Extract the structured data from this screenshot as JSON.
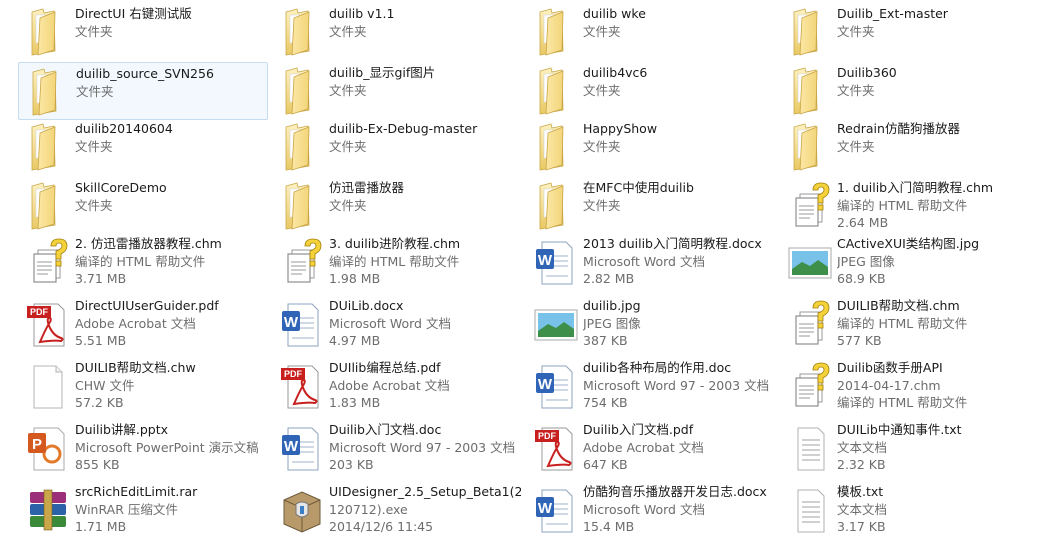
{
  "items": [
    {
      "name": "DirectUI 右键测试版",
      "lines": [
        "文件夹"
      ],
      "icon": "folder-icon"
    },
    {
      "name": "duilib v1.1",
      "lines": [
        "文件夹"
      ],
      "icon": "folder-icon"
    },
    {
      "name": "duilib wke",
      "lines": [
        "文件夹"
      ],
      "icon": "folder-icon"
    },
    {
      "name": "Duilib_Ext-master",
      "lines": [
        "文件夹"
      ],
      "icon": "folder-icon"
    },
    {
      "name": "duilib_source_SVN256",
      "lines": [
        "文件夹"
      ],
      "icon": "folder-icon",
      "selected": true
    },
    {
      "name": "duilib_显示gif图片",
      "lines": [
        "文件夹"
      ],
      "icon": "folder-icon"
    },
    {
      "name": "duilib4vc6",
      "lines": [
        "文件夹"
      ],
      "icon": "folder-icon"
    },
    {
      "name": "Duilib360",
      "lines": [
        "文件夹"
      ],
      "icon": "folder-icon"
    },
    {
      "name": "duilib20140604",
      "lines": [
        "文件夹"
      ],
      "icon": "folder-icon"
    },
    {
      "name": "duilib-Ex-Debug-master",
      "lines": [
        "文件夹"
      ],
      "icon": "folder-icon"
    },
    {
      "name": "HappyShow",
      "lines": [
        "文件夹"
      ],
      "icon": "folder-icon"
    },
    {
      "name": "Redrain仿酷狗播放器",
      "lines": [
        "文件夹"
      ],
      "icon": "folder-icon"
    },
    {
      "name": "SkillCoreDemo",
      "lines": [
        "文件夹"
      ],
      "icon": "folder-icon"
    },
    {
      "name": "仿迅雷播放器",
      "lines": [
        "文件夹"
      ],
      "icon": "folder-icon"
    },
    {
      "name": "在MFC中使用duilib",
      "lines": [
        "文件夹"
      ],
      "icon": "folder-icon"
    },
    {
      "name": "1. duilib入门简明教程.chm",
      "lines": [
        "编译的 HTML 帮助文件",
        "2.64 MB"
      ],
      "icon": "chm-help-icon"
    },
    {
      "name": "2. 仿迅雷播放器教程.chm",
      "lines": [
        "编译的 HTML 帮助文件",
        "3.71 MB"
      ],
      "icon": "chm-help-icon"
    },
    {
      "name": "3. duilib进阶教程.chm",
      "lines": [
        "编译的 HTML 帮助文件",
        "1.98 MB"
      ],
      "icon": "chm-help-icon"
    },
    {
      "name": "2013 duilib入门简明教程.docx",
      "lines": [
        "Microsoft Word 文档",
        "2.82 MB"
      ],
      "icon": "word-document-icon"
    },
    {
      "name": "CActiveXUI类结构图.jpg",
      "lines": [
        "JPEG 图像",
        "68.9 KB"
      ],
      "icon": "jpeg-image-icon"
    },
    {
      "name": "DirectUIUserGuider.pdf",
      "lines": [
        "Adobe Acrobat 文档",
        "5.51 MB"
      ],
      "icon": "pdf-document-icon"
    },
    {
      "name": "DUiLib.docx",
      "lines": [
        "Microsoft Word 文档",
        "4.97 MB"
      ],
      "icon": "word-document-icon"
    },
    {
      "name": "duilib.jpg",
      "lines": [
        "JPEG 图像",
        "387 KB"
      ],
      "icon": "jpeg-image-icon"
    },
    {
      "name": "DUILIB帮助文档.chm",
      "lines": [
        "编译的 HTML 帮助文件",
        "577 KB"
      ],
      "icon": "chm-help-icon"
    },
    {
      "name": "DUILIB帮助文档.chw",
      "lines": [
        "CHW 文件",
        "57.2 KB"
      ],
      "icon": "blank-file-icon"
    },
    {
      "name": "DUIlib编程总结.pdf",
      "lines": [
        "Adobe Acrobat 文档",
        "1.83 MB"
      ],
      "icon": "pdf-document-icon"
    },
    {
      "name": "duilib各种布局的作用.doc",
      "lines": [
        "Microsoft Word 97 - 2003 文档",
        "754 KB"
      ],
      "icon": "word-document-icon"
    },
    {
      "name": "Duilib函数手册API",
      "lines": [
        "2014-04-17.chm",
        "编译的 HTML 帮助文件"
      ],
      "icon": "chm-help-icon"
    },
    {
      "name": "Duilib讲解.pptx",
      "lines": [
        "Microsoft PowerPoint 演示文稿",
        "855 KB"
      ],
      "icon": "powerpoint-icon"
    },
    {
      "name": "Duilib入门文档.doc",
      "lines": [
        "Microsoft Word 97 - 2003 文档",
        "203 KB"
      ],
      "icon": "word-document-icon"
    },
    {
      "name": "Duilib入门文档.pdf",
      "lines": [
        "Adobe Acrobat 文档",
        "647 KB"
      ],
      "icon": "pdf-document-icon"
    },
    {
      "name": "DUILib中通知事件.txt",
      "lines": [
        "文本文档",
        "2.32 KB"
      ],
      "icon": "text-file-icon"
    },
    {
      "name": "srcRichEditLimit.rar",
      "lines": [
        "WinRAR 压缩文件",
        "1.71 MB"
      ],
      "icon": "winrar-archive-icon"
    },
    {
      "name": "UIDesigner_2.5_Setup_Beta1(20",
      "lines": [
        "120712).exe",
        "2014/12/6 11:45"
      ],
      "icon": "installer-exe-icon"
    },
    {
      "name": "仿酷狗音乐播放器开发日志.docx",
      "lines": [
        "Microsoft Word 文档",
        "15.4 MB"
      ],
      "icon": "word-document-icon"
    },
    {
      "name": "模板.txt",
      "lines": [
        "文本文档",
        "3.17 KB"
      ],
      "icon": "text-file-icon"
    }
  ]
}
